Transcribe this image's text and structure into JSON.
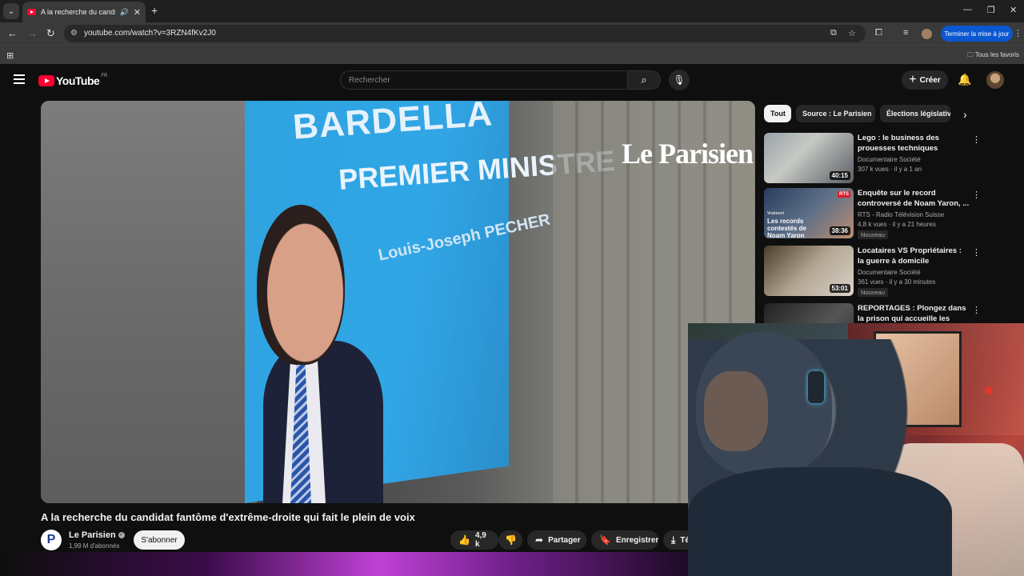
{
  "browser": {
    "tab_title": "A la recherche du candidat",
    "url": "youtube.com/watch?v=3RZN4fKv2J0",
    "update_label": "Terminer la mise à jour",
    "bookmarks_all": "Tous les favoris"
  },
  "youtube": {
    "logo_text": "YouTube",
    "country_code": "FR",
    "search_placeholder": "Rechercher",
    "create_label": "Créer"
  },
  "video": {
    "watermark": "Le Parisien",
    "poster_name": "BARDELLA",
    "poster_role": "PREMIER MINISTRE",
    "poster_sub": "Louis-Joseph PECHER",
    "title": "A la recherche du candidat fantôme d'extrême-droite qui fait le plein de voix",
    "channel": "Le Parisien",
    "subscribers": "1,99 M d'abonnés",
    "subscribe_label": "S'abonner",
    "likes": "4,9 k",
    "share_label": "Partager",
    "save_label": "Enregistrer",
    "download_label": "Té"
  },
  "chips": [
    {
      "label": "Tout",
      "active": true
    },
    {
      "label": "Source : Le Parisien",
      "active": false
    },
    {
      "label": "Élections législative",
      "active": false
    }
  ],
  "recommendations": [
    {
      "title": "Lego : le business des prouesses techniques",
      "channel": "Documentaire Société",
      "meta": "307 k vues · il y a 1 an",
      "duration": "40:15",
      "badge": ""
    },
    {
      "title": "Enquête sur le record controversé de Noam Yaron, ...",
      "channel": "RTS - Radio Télévision Suisse",
      "meta": "4,8 k vues · il y a 21 heures",
      "duration": "38:36",
      "badge": "Nouveau",
      "thumb_text": "Les records contestés de Noam Yaron",
      "thumb_small": "Vraiment",
      "thumb_logo": "RTS"
    },
    {
      "title": "Locataires VS Propriétaires : la guerre à domicile",
      "channel": "Documentaire Société",
      "meta": "361 vues · il y a 30 minutes",
      "duration": "53:01",
      "badge": "Nouveau"
    },
    {
      "title": "REPORTAGES : Plongez dans la prison qui accueille les détenu...",
      "channel": "",
      "meta": "",
      "duration": "",
      "badge": ""
    }
  ]
}
